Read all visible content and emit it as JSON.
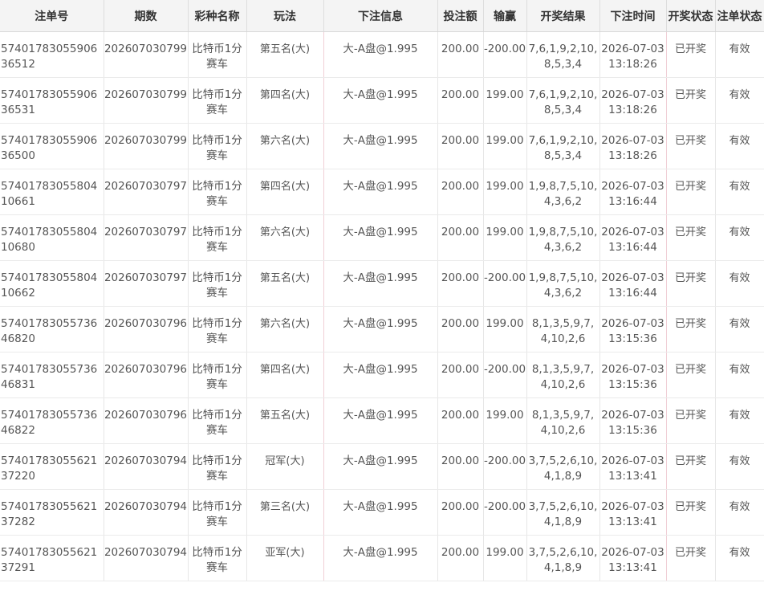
{
  "headers": [
    "注单号",
    "期数",
    "彩种名称",
    "玩法",
    "下注信息",
    "投注额",
    "输赢",
    "开奖结果",
    "下注时间",
    "开奖状态",
    "注单状态"
  ],
  "rows": [
    {
      "order": "5740178305590636512",
      "period": "202607030799",
      "lottery": "比特币1分赛车",
      "play": "第五名(大)",
      "bet": "大-A盘@1.995",
      "amount": "200.00",
      "win": "-200.00",
      "result": "7,6,1,9,2,10,8,5,3,4",
      "time": "2026-07-03 13:18:26",
      "draw": "已开奖",
      "status": "有效"
    },
    {
      "order": "5740178305590636531",
      "period": "202607030799",
      "lottery": "比特币1分赛车",
      "play": "第四名(大)",
      "bet": "大-A盘@1.995",
      "amount": "200.00",
      "win": "199.00",
      "result": "7,6,1,9,2,10,8,5,3,4",
      "time": "2026-07-03 13:18:26",
      "draw": "已开奖",
      "status": "有效"
    },
    {
      "order": "5740178305590636500",
      "period": "202607030799",
      "lottery": "比特币1分赛车",
      "play": "第六名(大)",
      "bet": "大-A盘@1.995",
      "amount": "200.00",
      "win": "199.00",
      "result": "7,6,1,9,2,10,8,5,3,4",
      "time": "2026-07-03 13:18:26",
      "draw": "已开奖",
      "status": "有效"
    },
    {
      "order": "5740178305580410661",
      "period": "202607030797",
      "lottery": "比特币1分赛车",
      "play": "第四名(大)",
      "bet": "大-A盘@1.995",
      "amount": "200.00",
      "win": "199.00",
      "result": "1,9,8,7,5,10,4,3,6,2",
      "time": "2026-07-03 13:16:44",
      "draw": "已开奖",
      "status": "有效"
    },
    {
      "order": "5740178305580410680",
      "period": "202607030797",
      "lottery": "比特币1分赛车",
      "play": "第六名(大)",
      "bet": "大-A盘@1.995",
      "amount": "200.00",
      "win": "199.00",
      "result": "1,9,8,7,5,10,4,3,6,2",
      "time": "2026-07-03 13:16:44",
      "draw": "已开奖",
      "status": "有效"
    },
    {
      "order": "5740178305580410662",
      "period": "202607030797",
      "lottery": "比特币1分赛车",
      "play": "第五名(大)",
      "bet": "大-A盘@1.995",
      "amount": "200.00",
      "win": "-200.00",
      "result": "1,9,8,7,5,10,4,3,6,2",
      "time": "2026-07-03 13:16:44",
      "draw": "已开奖",
      "status": "有效"
    },
    {
      "order": "5740178305573646820",
      "period": "202607030796",
      "lottery": "比特币1分赛车",
      "play": "第六名(大)",
      "bet": "大-A盘@1.995",
      "amount": "200.00",
      "win": "199.00",
      "result": "8,1,3,5,9,7,4,10,2,6",
      "time": "2026-07-03 13:15:36",
      "draw": "已开奖",
      "status": "有效"
    },
    {
      "order": "5740178305573646831",
      "period": "202607030796",
      "lottery": "比特币1分赛车",
      "play": "第四名(大)",
      "bet": "大-A盘@1.995",
      "amount": "200.00",
      "win": "-200.00",
      "result": "8,1,3,5,9,7,4,10,2,6",
      "time": "2026-07-03 13:15:36",
      "draw": "已开奖",
      "status": "有效"
    },
    {
      "order": "5740178305573646822",
      "period": "202607030796",
      "lottery": "比特币1分赛车",
      "play": "第五名(大)",
      "bet": "大-A盘@1.995",
      "amount": "200.00",
      "win": "199.00",
      "result": "8,1,3,5,9,7,4,10,2,6",
      "time": "2026-07-03 13:15:36",
      "draw": "已开奖",
      "status": "有效"
    },
    {
      "order": "5740178305562137220",
      "period": "202607030794",
      "lottery": "比特币1分赛车",
      "play": "冠军(大)",
      "bet": "大-A盘@1.995",
      "amount": "200.00",
      "win": "-200.00",
      "result": "3,7,5,2,6,10,4,1,8,9",
      "time": "2026-07-03 13:13:41",
      "draw": "已开奖",
      "status": "有效"
    },
    {
      "order": "5740178305562137282",
      "period": "202607030794",
      "lottery": "比特币1分赛车",
      "play": "第三名(大)",
      "bet": "大-A盘@1.995",
      "amount": "200.00",
      "win": "-200.00",
      "result": "3,7,5,2,6,10,4,1,8,9",
      "time": "2026-07-03 13:13:41",
      "draw": "已开奖",
      "status": "有效"
    },
    {
      "order": "5740178305562137291",
      "period": "202607030794",
      "lottery": "比特币1分赛车",
      "play": "亚军(大)",
      "bet": "大-A盘@1.995",
      "amount": "200.00",
      "win": "199.00",
      "result": "3,7,5,2,6,10,4,1,8,9",
      "time": "2026-07-03 13:13:41",
      "draw": "已开奖",
      "status": "有效"
    }
  ]
}
